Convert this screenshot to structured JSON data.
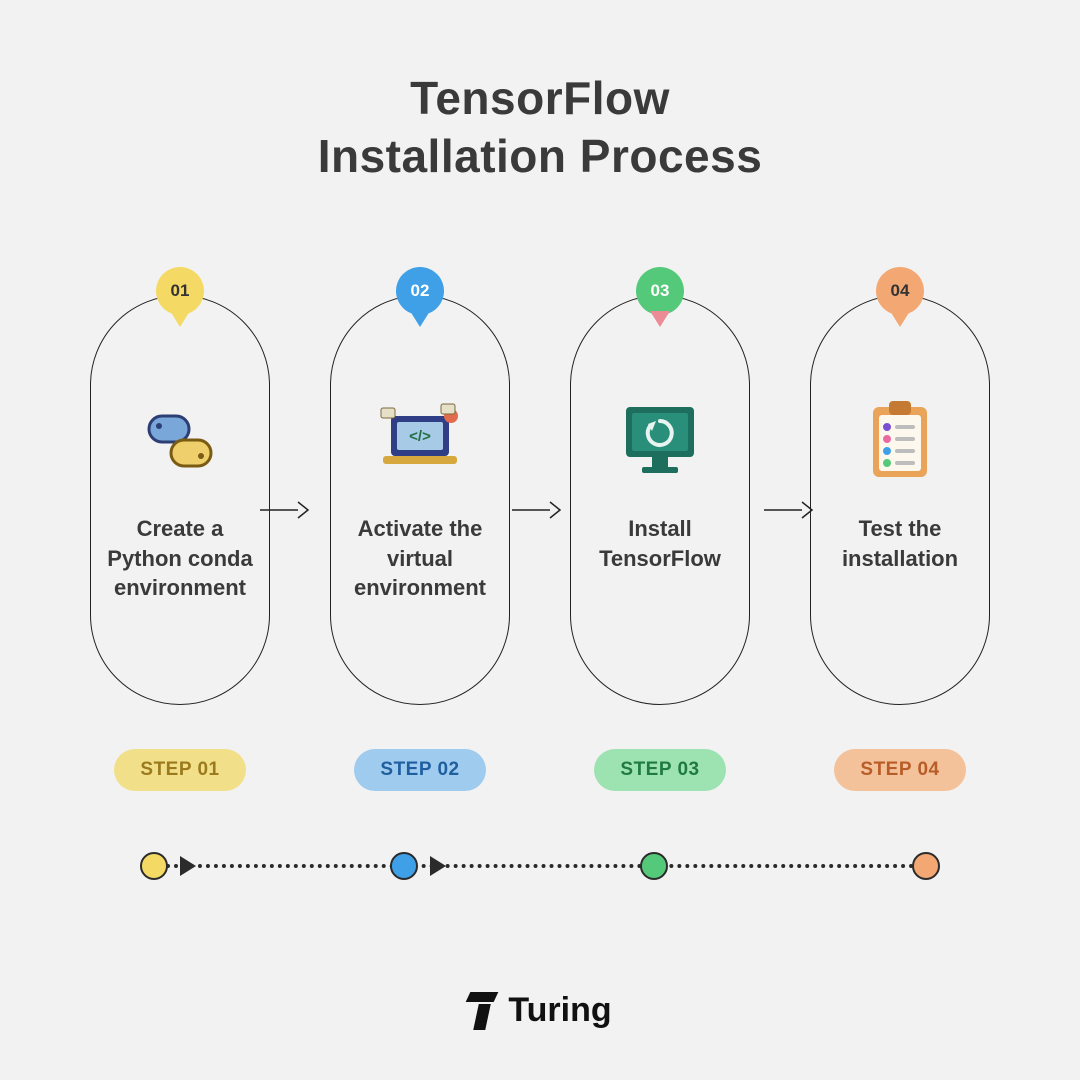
{
  "title": "TensorFlow\nInstallation Process",
  "steps": [
    {
      "num": "01",
      "label": "Create a\nPython conda\nenvironment",
      "badge": "STEP 01",
      "icon": "python-icon",
      "color": "yellow"
    },
    {
      "num": "02",
      "label": "Activate the\nvirtual\nenvironment",
      "badge": "STEP 02",
      "icon": "laptop-code-icon",
      "color": "blue"
    },
    {
      "num": "03",
      "label": "Install\nTensorFlow",
      "badge": "STEP 03",
      "icon": "monitor-refresh-icon",
      "color": "green"
    },
    {
      "num": "04",
      "label": "Test the\ninstallation",
      "badge": "STEP 04",
      "icon": "clipboard-checklist-icon",
      "color": "orange"
    }
  ],
  "brand": "Turing",
  "colors": {
    "yellow": "#f4da65",
    "blue": "#3fa0e8",
    "green": "#55c97a",
    "orange": "#f3a773",
    "bg": "#f2f2f2",
    "text": "#3a3a3a"
  }
}
